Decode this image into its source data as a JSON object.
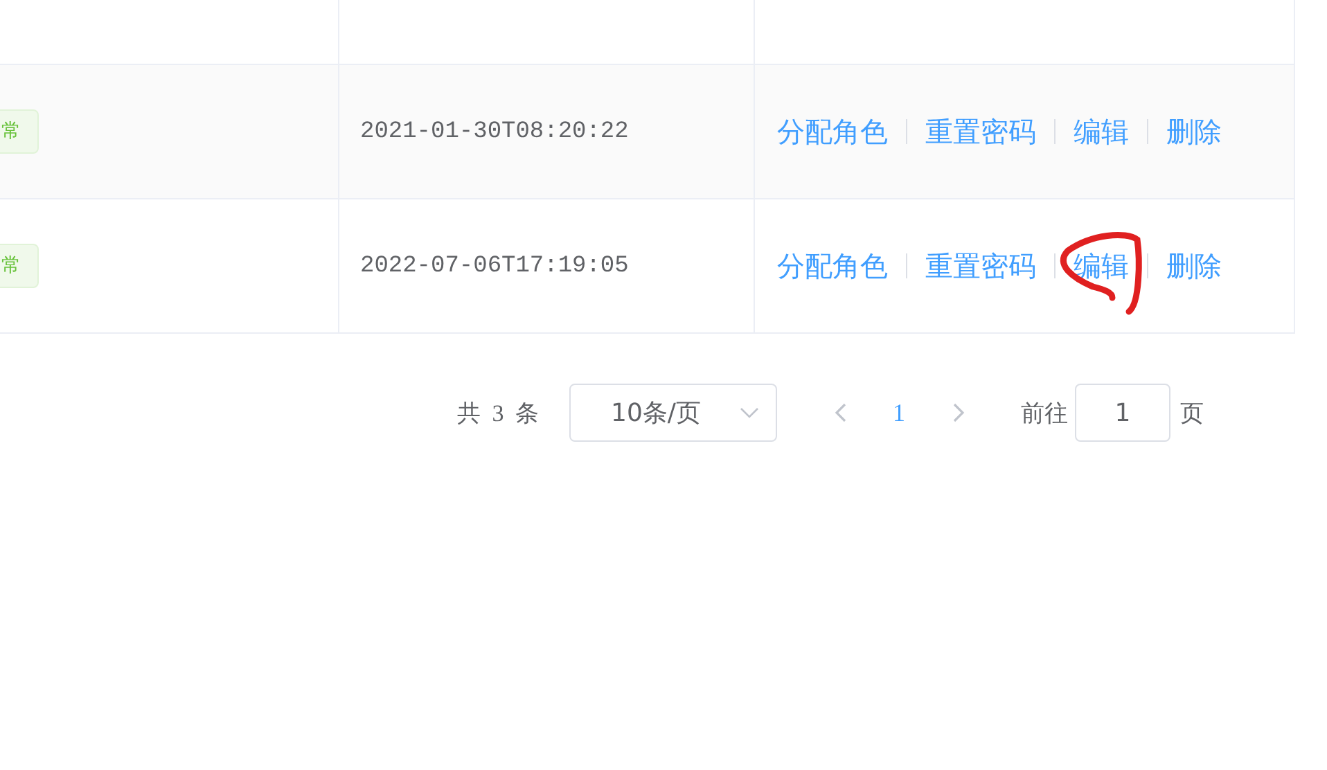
{
  "table": {
    "rows": [
      {
        "status": "常",
        "time": "2021-01-30T08:20:22",
        "actions": [
          {
            "label": "分配角色",
            "circled": false
          },
          {
            "label": "重置密码",
            "circled": false
          },
          {
            "label": "编辑",
            "circled": false
          },
          {
            "label": "删除",
            "circled": false
          }
        ]
      },
      {
        "status": "常",
        "time": "2022-07-06T17:19:05",
        "actions": [
          {
            "label": "分配角色",
            "circled": false
          },
          {
            "label": "重置密码",
            "circled": false
          },
          {
            "label": "编辑",
            "circled": true
          },
          {
            "label": "删除",
            "circled": false
          }
        ]
      }
    ]
  },
  "pagination": {
    "total": "共 3 条",
    "page_size": "10条/页",
    "pages": [
      {
        "label": "1",
        "selected": true
      }
    ],
    "goto_label": "前往",
    "goto_value": "1",
    "page_unit": "页"
  }
}
